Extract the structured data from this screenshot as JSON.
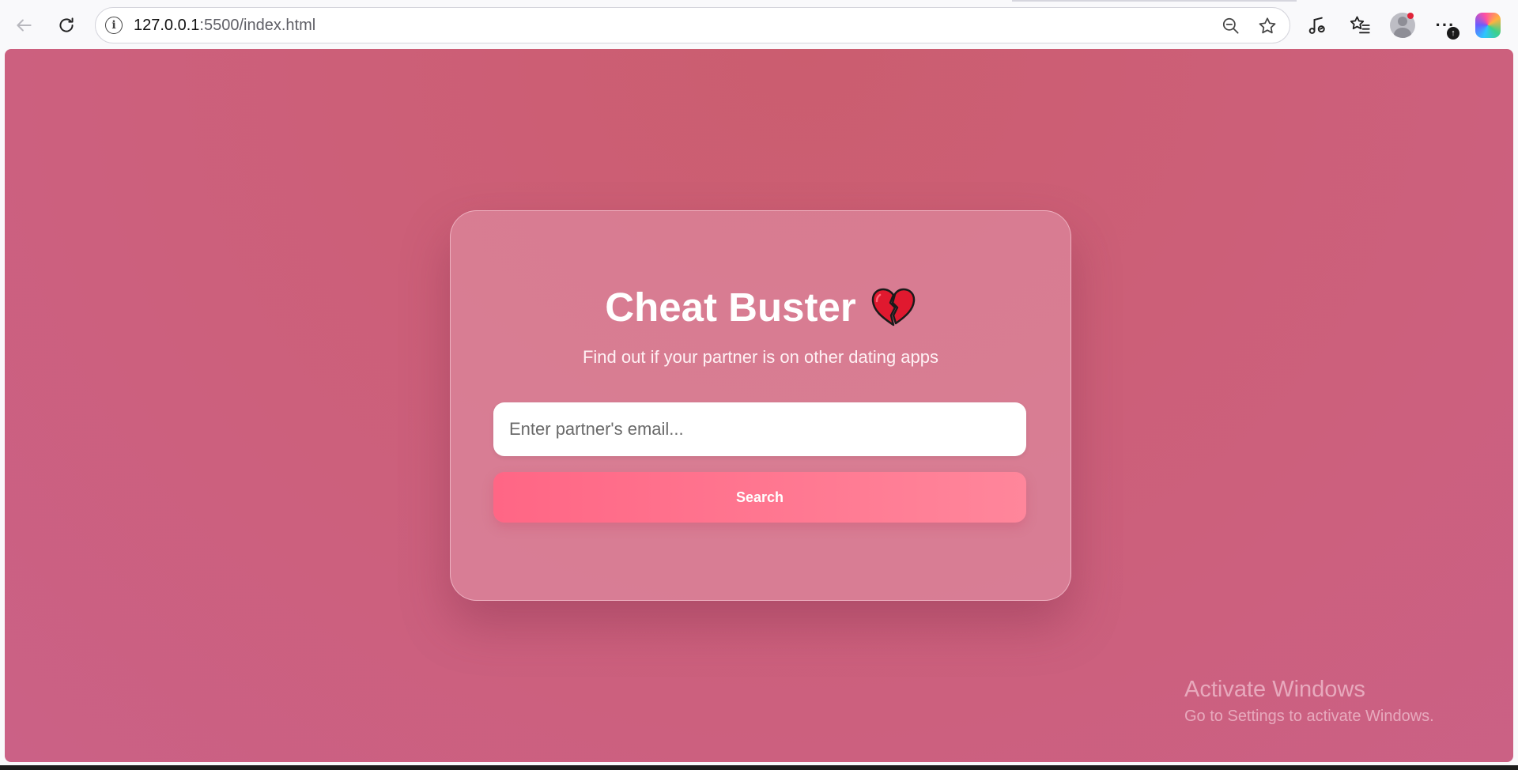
{
  "browser": {
    "url_host": "127.0.0.1",
    "url_path": ":5500/index.html",
    "icons": [
      "back-arrow-icon",
      "reload-icon",
      "site-info-icon",
      "zoom-out-icon",
      "favorite-star-icon",
      "media-icon",
      "favorites-list-icon",
      "profile-icon",
      "more-icon",
      "copilot-icon"
    ]
  },
  "app": {
    "title": "Cheat Buster",
    "title_emoji": "broken-heart-icon",
    "subtitle": "Find out if your partner is on other dating apps",
    "email_placeholder": "Enter partner's email...",
    "email_value": "",
    "search_label": "Search",
    "colors": {
      "background": "#cb5f7a",
      "button_start": "#ff6685",
      "button_end": "#ff869b"
    }
  },
  "watermark": {
    "title": "Activate Windows",
    "subtitle": "Go to Settings to activate Windows."
  }
}
